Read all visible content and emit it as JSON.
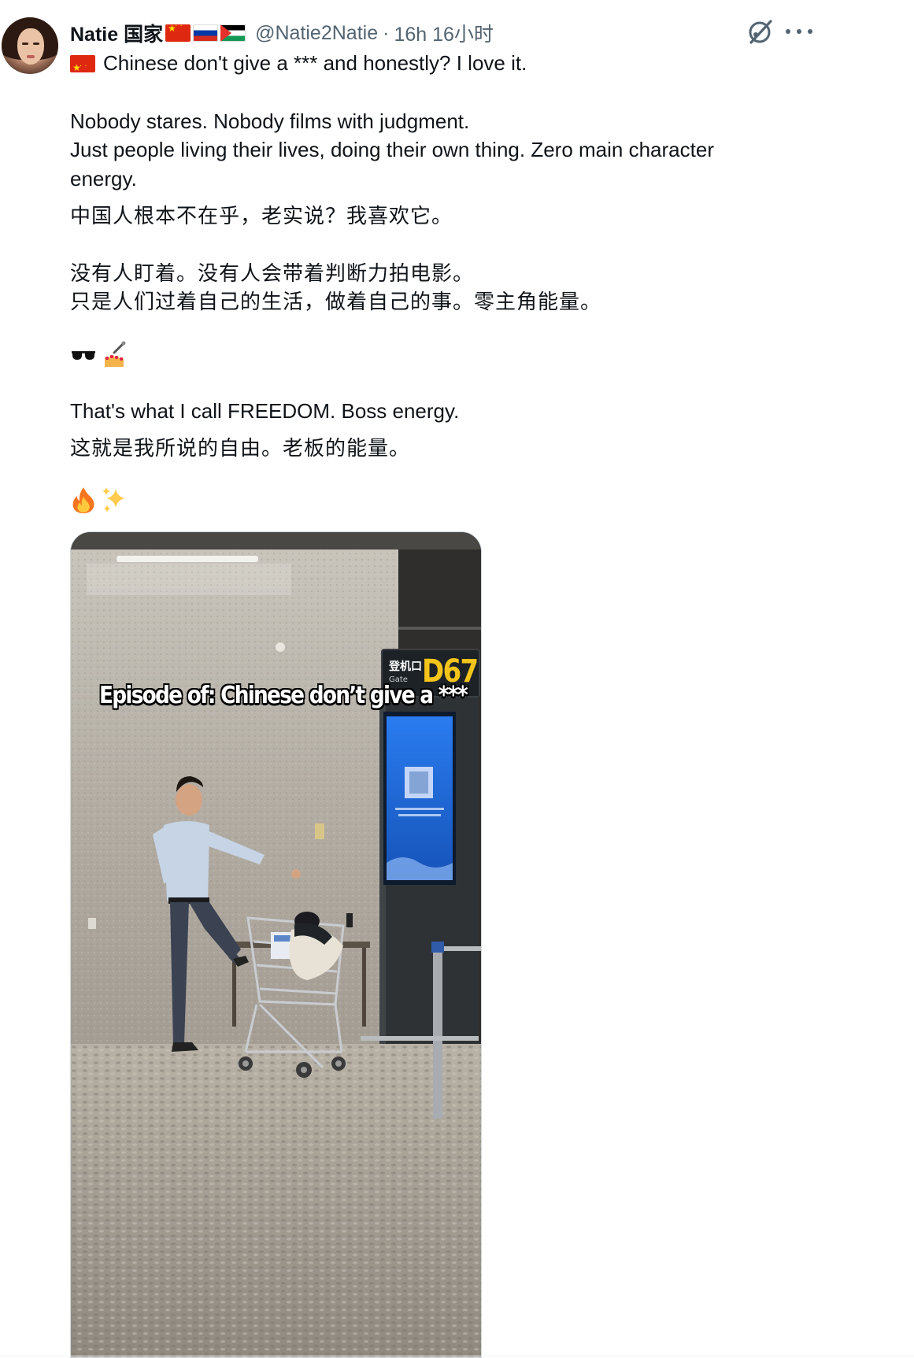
{
  "author": {
    "display_name": "Natie 国家",
    "flags": [
      "china-flag",
      "russia-flag",
      "palestine-flag"
    ],
    "handle": "@Natie2Natie",
    "separator": "·",
    "timestamp": "16h 16小时"
  },
  "icons": {
    "grok": "grok-icon",
    "more": "more-options-icon"
  },
  "tweet": {
    "line1": "Chinese don't give a *** and honestly? I love it.",
    "line2": "Nobody stares. Nobody films with judgment.",
    "line3": "Just people living their lives, doing their own thing. Zero main character",
    "line4": "energy.",
    "line5": "中国人根本不在乎，老实说？我喜欢它。",
    "line6": "没有人盯着。没有人会带着判断力拍电影。",
    "line7": "只是人们过着自己的生活，做着自己的事。零主角能量。",
    "emoji1": [
      "sunglasses-emoji",
      "nail-polish-emoji"
    ],
    "line8": "That's what I call FREEDOM. Boss energy.",
    "line9": "这就是我所说的自由。老板的能量。",
    "emoji2": [
      "fire-emoji",
      "sparkles-emoji"
    ]
  },
  "media": {
    "caption": "Episode of: Chinese don’t give a ***",
    "gate_label_cn": "登机口",
    "gate_label_en": "Gate",
    "gate_code": "D67"
  },
  "colors": {
    "text": "#0f1419",
    "secondary": "#536471",
    "gate_yellow": "#f3c419",
    "screen_blue": "#1f6fe0"
  }
}
